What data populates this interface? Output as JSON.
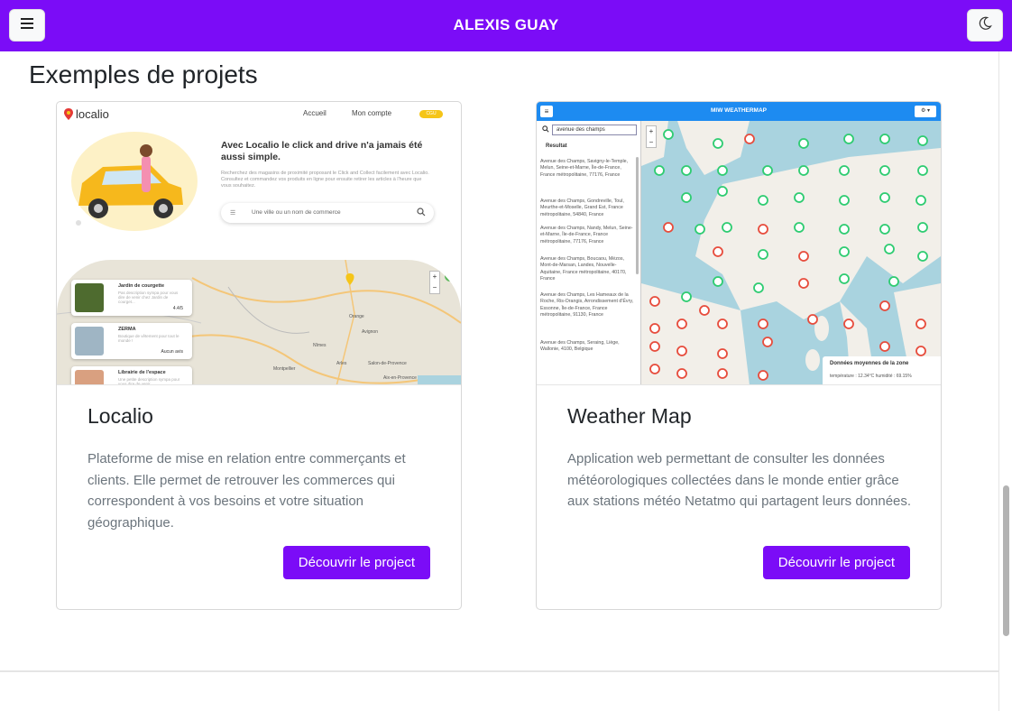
{
  "header": {
    "brand": "ALEXIS GUAY",
    "menu_icon": "hamburger-icon",
    "theme_icon": "moon-icon",
    "accent_color": "#7b0cf7"
  },
  "section": {
    "title": "Exemples de projets"
  },
  "projects": [
    {
      "title": "Localio",
      "description": "Plateforme de mise en relation entre commerçants et clients. Elle permet de retrouver les commerces qui correspondent à vos besoins et votre situation géographique.",
      "button_label": "Découvrir le project",
      "thumbnail": {
        "logo": "localio",
        "nav_home": "Accueil",
        "nav_account": "Mon compte",
        "pill": "CGU",
        "headline": "Avec Localio le click and drive n'a jamais été aussi simple.",
        "subtext": "Recherchez des magasins de proximité proposant le Click and Collect facilement avec Localio. Consultez et commandez vos produits en ligne pour ensuite retirer les articles à l'heure que vous souhaitez.",
        "search_placeholder": "Une ville ou un nom de commerce",
        "shops": [
          {
            "name": "Jardin de courgette",
            "desc": "Pas description sympa pour vous dire de venir chez Jardin de courget...",
            "rating": "4.4/5"
          },
          {
            "name": "ZERMA",
            "desc": "Boutique de vêtement pour tout le monde !",
            "rating": "Aucun avis"
          },
          {
            "name": "Librairie de l'espace",
            "desc": "Une petite description sympa pour vous dire de venir",
            "rating": ""
          }
        ],
        "map_labels": [
          "Orange",
          "Nîmes",
          "Avignon",
          "Montpellier",
          "Arles",
          "Salon-de-Provence",
          "Aix-en-Provence"
        ]
      }
    },
    {
      "title": "Weather Map",
      "description": "Application web permettant de consulter les données météorologiques collectées dans le monde entier grâce aux stations météo Netatmo qui partagent leurs données.",
      "button_label": "Découvrir le project",
      "thumbnail": {
        "app_title": "MIW WEATHERMAP",
        "search_value": "avenue des champs",
        "results_label": "Resultat",
        "results": [
          "Avenue des Champs, Savigny-le-Temple, Melun, Seine-et-Marne, Île-de-France, France métropolitaine, 77176, France",
          "Avenue des Champs, Gondreville, Toul, Meurthe-et-Moselle, Grand Est, France métropolitaine, 54840, France",
          "Avenue des Champs, Nandy, Melun, Seine-et-Marne, Île-de-France, France métropolitaine, 77176, France",
          "Avenue des Champs, Boucaou, Mézos, Mont-de-Marsan, Landes, Nouvelle-Aquitaine, France métropolitaine, 40170, France",
          "Avenue des Champs, Les Hameaux de la Roche, Ris-Orangis, Arrondissement d'Évry, Essonne, Île-de-France, France métropolitaine, 91130, France",
          "Avenue des Champs, Seraing, Liège, Wallonie, 4100, Belgique"
        ],
        "legend_title": "Données moyennes de la zone",
        "legend_values": "température : 12.34°C humidité : 69.15%"
      }
    }
  ]
}
